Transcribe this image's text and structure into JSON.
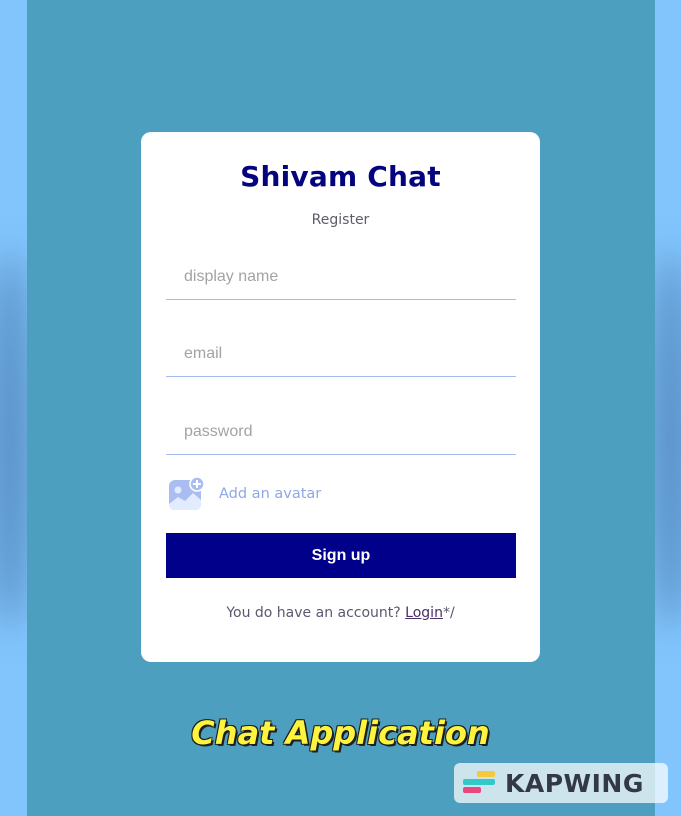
{
  "app": {
    "title": "Shivam Chat",
    "subtitle": "Register"
  },
  "form": {
    "display_name": {
      "placeholder": "display name",
      "value": ""
    },
    "email": {
      "placeholder": "email",
      "value": ""
    },
    "password": {
      "placeholder": "password",
      "value": ""
    },
    "avatar": {
      "label": "Add an avatar",
      "icon": "add-image-icon"
    },
    "submit_label": "Sign up"
  },
  "footer": {
    "text": "You do have an account? ",
    "link_label": "Login",
    "trailing": "*/"
  },
  "caption": "Chat Application",
  "watermark": {
    "text": "KAPWING"
  },
  "colors": {
    "page_bg": "#82c5fd",
    "stage_bg": "#4c9fbe",
    "brand": "#04047f",
    "button": "#00008b",
    "caption": "#fef43e",
    "avatar_accent": "#8ea8e6"
  }
}
